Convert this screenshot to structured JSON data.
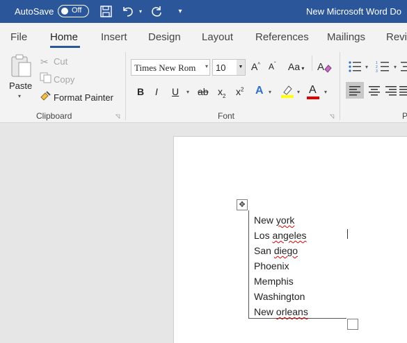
{
  "titlebar": {
    "autosave_label": "AutoSave",
    "autosave_state": "Off",
    "doc_title": "New Microsoft Word Do",
    "icons": [
      "save-icon",
      "undo-icon",
      "redo-icon",
      "customize-quick-access-icon"
    ]
  },
  "tabs": [
    {
      "label": "File"
    },
    {
      "label": "Home"
    },
    {
      "label": "Insert"
    },
    {
      "label": "Design"
    },
    {
      "label": "Layout"
    },
    {
      "label": "References"
    },
    {
      "label": "Mailings"
    },
    {
      "label": "Revi"
    }
  ],
  "clipboard": {
    "paste_label": "Paste",
    "cut_label": "Cut",
    "copy_label": "Copy",
    "format_painter_label": "Format Painter",
    "group_label": "Clipboard"
  },
  "font": {
    "font_name": "Times New Rom",
    "font_size": "10",
    "grow_label": "A",
    "shrink_label": "A",
    "change_case_label": "Aa",
    "bold_label": "B",
    "italic_label": "I",
    "underline_label": "U",
    "strikethrough_label": "ab",
    "subscript_label": "x",
    "superscript_label": "x",
    "text_effects_label": "A",
    "font_color_label": "A",
    "group_label": "Font"
  },
  "paragraph": {
    "group_label": "P"
  },
  "colors": {
    "titlebar": "#2b579a",
    "highlight": "#ffff00",
    "font_color": "#e00000",
    "spell_error": "#d00000"
  },
  "document": {
    "cities": [
      {
        "text": "New york",
        "parts": [
          "New ",
          "york"
        ]
      },
      {
        "text": "Los angeles",
        "parts": [
          "Los ",
          "angeles"
        ]
      },
      {
        "text": "San diego",
        "parts": [
          "San ",
          "diego"
        ]
      },
      {
        "text": "Phoenix",
        "parts": [
          "Phoenix",
          ""
        ]
      },
      {
        "text": "Memphis",
        "parts": [
          "Memphis",
          ""
        ]
      },
      {
        "text": "Washington",
        "parts": [
          "Washington",
          ""
        ]
      },
      {
        "text": "New orleans",
        "parts": [
          "New ",
          "orleans"
        ]
      }
    ]
  }
}
